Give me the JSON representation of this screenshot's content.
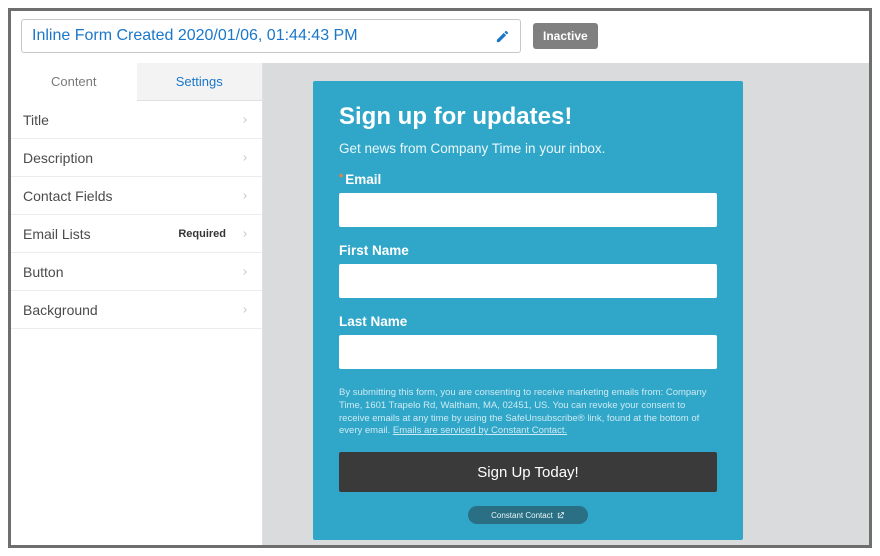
{
  "header": {
    "title": "Inline Form Created 2020/01/06, 01:44:43 PM",
    "status": "Inactive"
  },
  "tabs": {
    "content": "Content",
    "settings": "Settings",
    "active": "content"
  },
  "panels": [
    {
      "label": "Title"
    },
    {
      "label": "Description"
    },
    {
      "label": "Contact Fields"
    },
    {
      "label": "Email Lists",
      "required": "Required"
    },
    {
      "label": "Button"
    },
    {
      "label": "Background"
    }
  ],
  "form": {
    "title": "Sign up for updates!",
    "description": "Get news from Company Time in your inbox.",
    "fields": {
      "email_label": "Email",
      "first_name_label": "First Name",
      "last_name_label": "Last Name"
    },
    "disclaimer_a": "By submitting this form, you are consenting to receive marketing emails from: Company Time, 1601 Trapelo Rd, Waltham, MA, 02451, US. You can revoke your consent to receive emails at any time by using the SafeUnsubscribe® link, found at the bottom of every email. ",
    "disclaimer_link": "Emails are serviced by Constant Contact.",
    "submit": "Sign Up Today!",
    "provider": "Constant Contact"
  },
  "colors": {
    "accent": "#1b77c9",
    "card_bg": "#30a7c9",
    "button_bg": "#3a3a3a"
  }
}
